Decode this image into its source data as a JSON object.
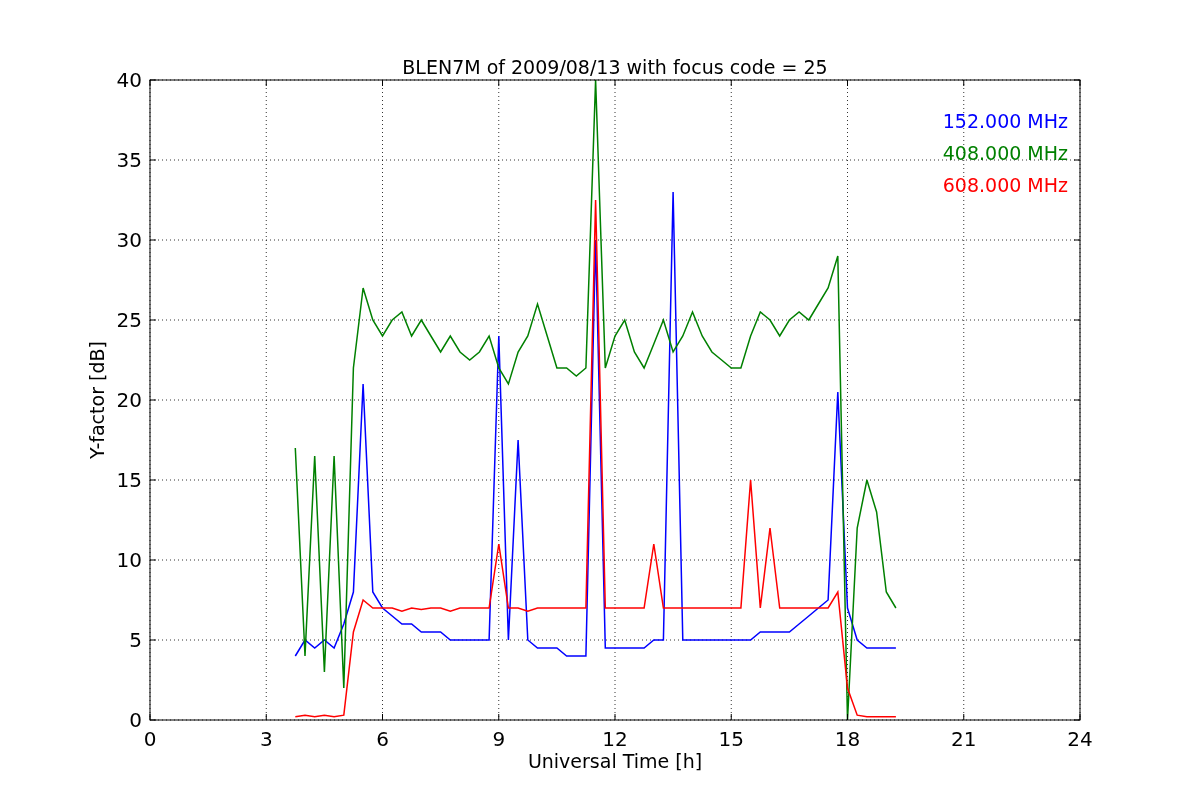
{
  "chart_data": {
    "type": "line",
    "title": "BLEN7M of 2009/08/13 with focus code = 25",
    "xlabel": "Universal Time [h]",
    "ylabel": "Y-factor [dB]",
    "x": [
      3.75,
      4,
      4.25,
      4.5,
      4.75,
      5,
      5.25,
      5.5,
      5.75,
      6,
      6.25,
      6.5,
      6.75,
      7,
      7.25,
      7.5,
      7.75,
      8,
      8.25,
      8.5,
      8.75,
      9,
      9.25,
      9.5,
      9.75,
      10,
      10.25,
      10.5,
      10.75,
      11,
      11.25,
      11.5,
      11.75,
      12,
      12.25,
      12.5,
      12.75,
      13,
      13.25,
      13.5,
      13.75,
      14,
      14.25,
      14.5,
      14.75,
      15,
      15.25,
      15.5,
      15.75,
      16,
      16.25,
      16.5,
      16.75,
      17,
      17.25,
      17.5,
      17.75,
      18,
      18.25,
      18.5,
      18.75,
      19,
      19.25
    ],
    "series": [
      {
        "name": "152.000 MHz",
        "color": "#0000ff",
        "values": [
          4,
          5,
          4.5,
          5,
          4.5,
          6,
          8,
          21,
          8,
          7,
          6.5,
          6,
          6,
          5.5,
          5.5,
          5.5,
          5,
          5,
          5,
          5,
          5,
          24,
          5,
          17.5,
          5,
          4.5,
          4.5,
          4.5,
          4,
          4,
          4,
          30,
          4.5,
          4.5,
          4.5,
          4.5,
          4.5,
          5,
          5,
          33,
          5,
          5,
          5,
          5,
          5,
          5,
          5,
          5,
          5.5,
          5.5,
          5.5,
          5.5,
          6,
          6.5,
          7,
          7.5,
          20.5,
          7,
          5,
          4.5,
          4.5,
          4.5,
          4.5
        ]
      },
      {
        "name": "408.000 MHz",
        "color": "#008000",
        "values": [
          17,
          4,
          16.5,
          3,
          16.5,
          2,
          22,
          27,
          25,
          24,
          25,
          25.5,
          24,
          25,
          24,
          23,
          24,
          23,
          22.5,
          23,
          24,
          22,
          21,
          23,
          24,
          26,
          24,
          22,
          22,
          21.5,
          22,
          40,
          22,
          24,
          25,
          23,
          22,
          23.5,
          25,
          23,
          24,
          25.5,
          24,
          23,
          22.5,
          22,
          22,
          24,
          25.5,
          25,
          24,
          25,
          25.5,
          25,
          26,
          27,
          29,
          0,
          12,
          15,
          13,
          8,
          7
        ]
      },
      {
        "name": "608.000 MHz",
        "color": "#ff0000",
        "values": [
          0.2,
          0.3,
          0.2,
          0.3,
          0.2,
          0.3,
          5.5,
          7.5,
          7,
          7,
          7,
          6.8,
          7,
          6.9,
          7,
          7,
          6.8,
          7,
          7,
          7,
          7,
          11,
          7,
          7,
          6.8,
          7,
          7,
          7,
          7,
          7,
          7,
          32.5,
          7,
          7,
          7,
          7,
          7,
          11,
          7,
          7,
          7,
          7,
          7,
          7,
          7,
          7,
          7,
          15,
          7,
          12,
          7,
          7,
          7,
          7,
          7,
          7,
          8,
          2,
          0.3,
          0.2,
          0.2,
          0.2,
          0.2
        ]
      }
    ],
    "grid": true,
    "xlim": [
      0,
      24
    ],
    "ylim": [
      0,
      40
    ],
    "xticks": [
      0,
      3,
      6,
      9,
      12,
      15,
      18,
      21,
      24
    ],
    "yticks": [
      0,
      5,
      10,
      15,
      20,
      25,
      30,
      35,
      40
    ]
  }
}
